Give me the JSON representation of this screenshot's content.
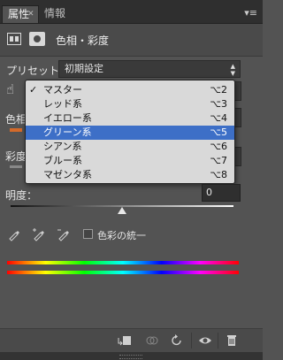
{
  "tabs": [
    {
      "label": "属性",
      "active": true
    },
    {
      "label": "情報",
      "active": false
    }
  ],
  "panel": {
    "title": "色相・彩度",
    "preset_label": "プリセット：",
    "preset_value": "初期設定",
    "hue_label": "色相",
    "saturation_label": "彩度",
    "lightness_label": "明度：",
    "lightness_value": "0",
    "colorize_label": "色彩の統一",
    "colorize_checked": false
  },
  "dropdown": {
    "items": [
      {
        "label": "マスター",
        "shortcut": "⌥2",
        "checked": true,
        "highlighted": false
      },
      {
        "label": "レッド系",
        "shortcut": "⌥3",
        "checked": false,
        "highlighted": false
      },
      {
        "label": "イエロー系",
        "shortcut": "⌥4",
        "checked": false,
        "highlighted": false
      },
      {
        "label": "グリーン系",
        "shortcut": "⌥5",
        "checked": false,
        "highlighted": true
      },
      {
        "label": "シアン系",
        "shortcut": "⌥6",
        "checked": false,
        "highlighted": false
      },
      {
        "label": "ブルー系",
        "shortcut": "⌥7",
        "checked": false,
        "highlighted": false
      },
      {
        "label": "マゼンタ系",
        "shortcut": "⌥8",
        "checked": false,
        "highlighted": false
      }
    ],
    "check_mark": "✓",
    "highlight_color": "#3d6fc7"
  },
  "slider": {
    "lightness_fraction": 0.5
  },
  "colors": {
    "panel_bg": "#535353",
    "spectrum": [
      "#ff0000",
      "#ffff00",
      "#00ff00",
      "#00ffff",
      "#0000ff",
      "#ff00ff",
      "#ff0000"
    ]
  },
  "icons": {
    "tab_close": "close-icon",
    "panel_menu": "panel-menu-icon",
    "adjustment": "adjustment-layer-icon",
    "mask": "mask-icon",
    "hand": "targeted-adjustment-hand-icon",
    "bottom": [
      "clip-to-layer-icon",
      "view-previous-state-icon",
      "reset-icon",
      "visibility-icon",
      "trash-icon"
    ]
  }
}
